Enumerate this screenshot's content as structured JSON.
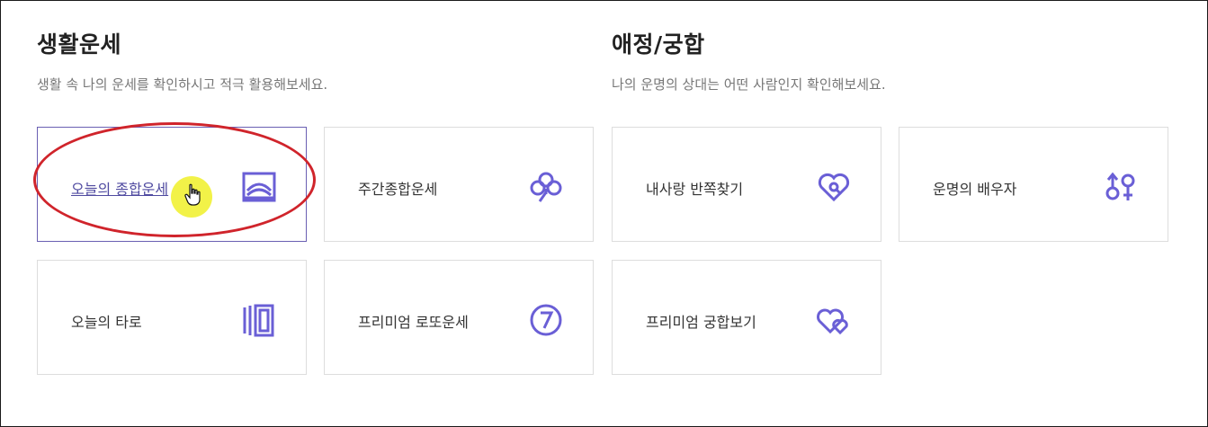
{
  "fortune": {
    "title": "생활운세",
    "description": "생활 속 나의 운세를 확인하시고 적극 활용해보세요.",
    "cards": [
      {
        "label": "오늘의 종합운세",
        "icon": "sunrise-frame-icon"
      },
      {
        "label": "주간종합운세",
        "icon": "clover-icon"
      },
      {
        "label": "오늘의 타로",
        "icon": "tarot-cards-icon"
      },
      {
        "label": "프리미엄 로또운세",
        "icon": "number-seven-circle-icon"
      }
    ]
  },
  "love": {
    "title": "애정/궁합",
    "description": "나의 운명의 상대는 어떤 사람인지 확인해보세요.",
    "cards": [
      {
        "label": "내사랑 반쪽찾기",
        "icon": "heart-search-icon"
      },
      {
        "label": "운명의 배우자",
        "icon": "gender-symbols-icon"
      },
      {
        "label": "프리미엄 궁합보기",
        "icon": "double-heart-icon"
      }
    ]
  },
  "colors": {
    "accent": "#6a5fd6",
    "annotation": "#d0242b",
    "cursor_highlight": "#f0f028"
  }
}
